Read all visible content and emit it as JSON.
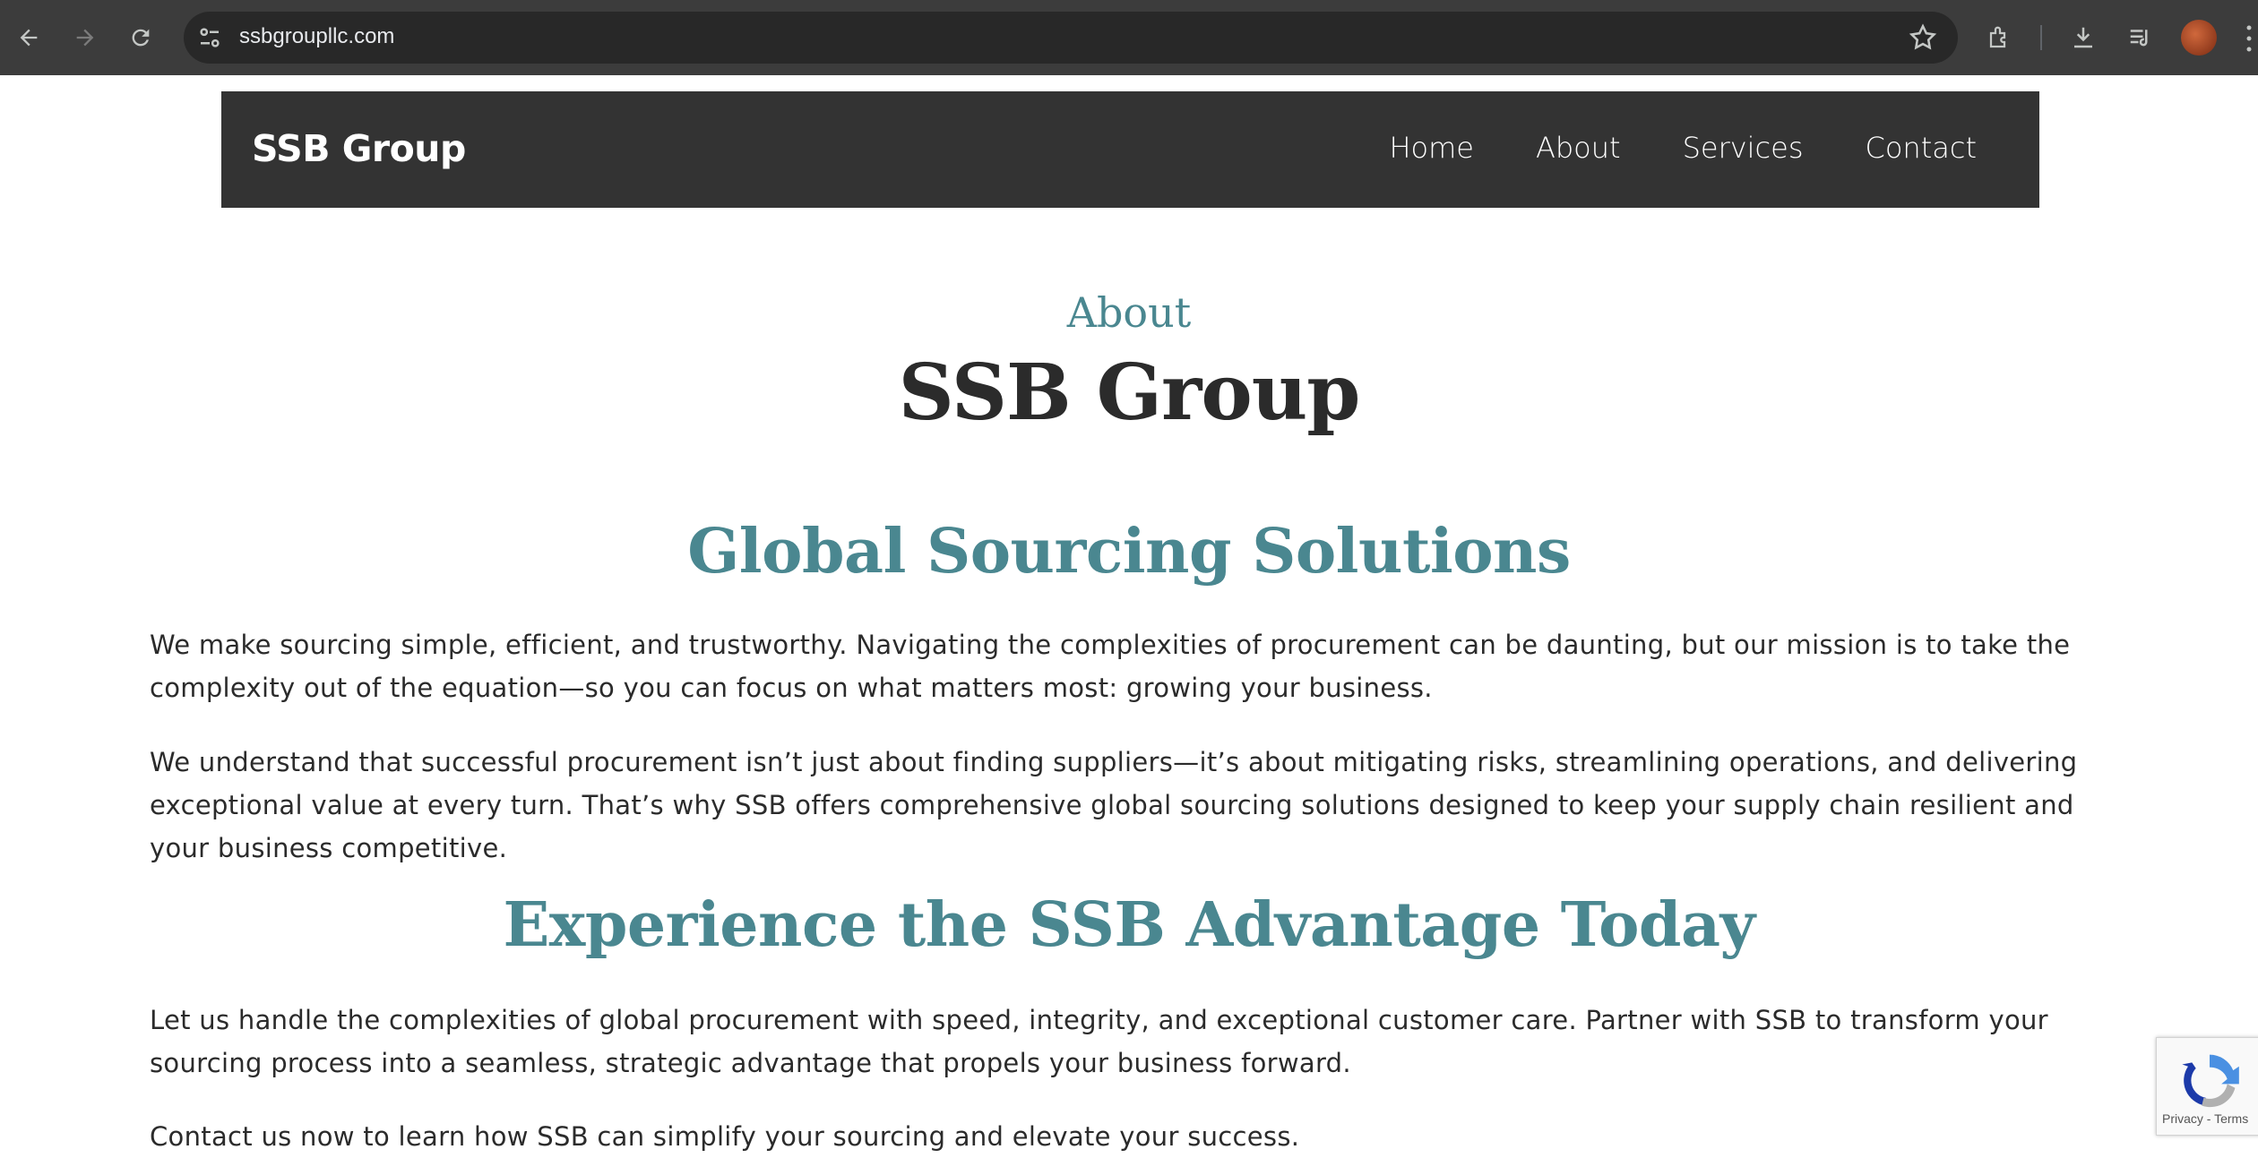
{
  "browser": {
    "url": "ssbgroupllc.com",
    "icons": [
      "back-icon",
      "forward-icon",
      "reload-icon",
      "site-info-icon",
      "bookmark-star-icon",
      "extensions-icon",
      "download-icon",
      "media-queue-icon",
      "profile-avatar",
      "menu-kebab-icon"
    ]
  },
  "nav": {
    "brand": "SSB Group",
    "links": [
      "Home",
      "About",
      "Services",
      "Contact"
    ]
  },
  "hero": {
    "eyebrow": "About",
    "title": "SSB Group"
  },
  "sections": {
    "heading1": "Global Sourcing Solutions",
    "para1": "We make sourcing simple, efficient, and trustworthy. Navigating the complexities of procurement can be daunting, but our mission is to take the complexity out of the equation—so you can focus on what matters most: growing your business.",
    "para2": "We understand that successful procurement isn’t just about finding suppliers—it’s about mitigating risks, streamlining operations, and delivering exceptional value at every turn. That’s why SSB offers comprehensive global sourcing solutions designed to keep your supply chain resilient and your business competitive.",
    "heading2": "Experience the SSB Advantage Today",
    "para3": "Let us handle the complexities of global procurement with speed, integrity, and exceptional customer care. Partner with SSB to transform your sourcing process into a seamless, strategic advantage that propels your business forward.",
    "para4": "Contact us now to learn how SSB can simplify your sourcing and elevate your success."
  },
  "recaptcha": {
    "terms": "Privacy - Terms"
  },
  "colors": {
    "accent": "#4a8790",
    "nav_bg": "#333333",
    "text": "#2b2b2b"
  }
}
